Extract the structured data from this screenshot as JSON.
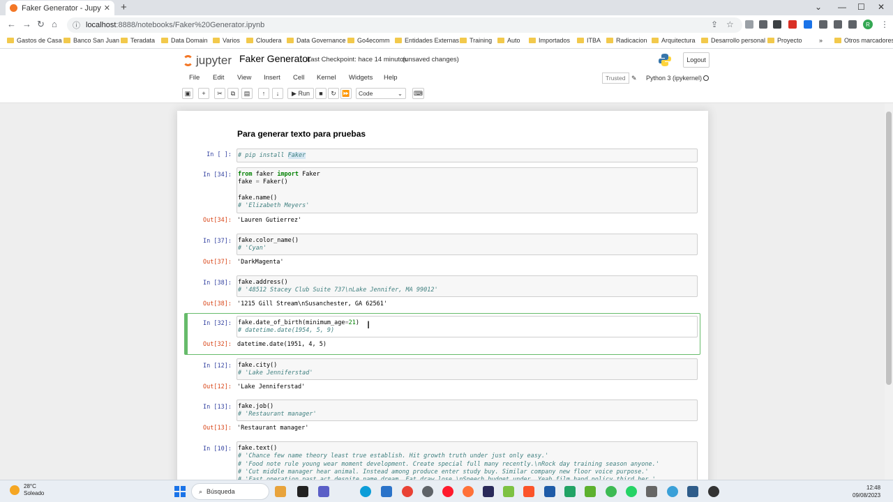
{
  "browser": {
    "tab_title": "Faker Generator - Jupyter Notebook",
    "new_tab": "+",
    "url_host": "localhost",
    "url_path": ":8888/notebooks/Faker%20Generator.ipynb",
    "bookmarks": [
      "Gastos de Casa",
      "Banco San Juan",
      "Teradata",
      "Data Domain",
      "Varios",
      "Cloudera",
      "Data Governance",
      "Go4ecomm",
      "Entidades Externas",
      "Training",
      "Auto",
      "Importados",
      "ITBA",
      "Radicacion",
      "Arquitectura",
      "Desarrollo personal",
      "Proyecto",
      "»",
      "Otros marcadores"
    ],
    "profile_initial": "R"
  },
  "jupyter": {
    "logo_text": "jupyter",
    "notebook_name": "Faker Generator",
    "checkpoint": "Last Checkpoint: hace 14 minutos",
    "unsaved": "(unsaved changes)",
    "logout": "Logout",
    "menus": [
      "File",
      "Edit",
      "View",
      "Insert",
      "Cell",
      "Kernel",
      "Widgets",
      "Help"
    ],
    "trusted": "Trusted",
    "kernel": "Python 3 (ipykernel)",
    "run_label": "Run",
    "cell_type": "Code"
  },
  "notebook": {
    "heading": "Para generar texto para pruebas",
    "cells": [
      {
        "in": "In [ ]:",
        "lines": [
          "# pip install Faker"
        ]
      },
      {
        "in": "In [34]:",
        "lines": [
          "from faker import Faker",
          "fake = Faker()",
          "",
          "fake.name()",
          "# 'Elizabeth Meyers'"
        ],
        "out_label": "Out[34]:",
        "out": "'Lauren Gutierrez'"
      },
      {
        "in": "In [37]:",
        "lines": [
          "fake.color_name()",
          "# 'Cyan'"
        ],
        "out_label": "Out[37]:",
        "out": "'DarkMagenta'"
      },
      {
        "in": "In [38]:",
        "lines": [
          "fake.address()",
          "# '48512 Stacey Club Suite 737\\nLake Jennifer, MA 99012'"
        ],
        "out_label": "Out[38]:",
        "out": "'1215 Gill Stream\\nSusanchester, GA 62561'"
      },
      {
        "in": "In [32]:",
        "lines": [
          "fake.date_of_birth(minimum_age=21)",
          "# datetime.date(1954, 5, 9)"
        ],
        "out_label": "Out[32]:",
        "out": "datetime.date(1951, 4, 5)"
      },
      {
        "in": "In [12]:",
        "lines": [
          "fake.city()",
          "# 'Lake Jenniferstad'"
        ],
        "out_label": "Out[12]:",
        "out": "'Lake Jenniferstad'"
      },
      {
        "in": "In [13]:",
        "lines": [
          "fake.job()",
          "# 'Restaurant manager'"
        ],
        "out_label": "Out[13]:",
        "out": "'Restaurant manager'"
      },
      {
        "in": "In [10]:",
        "lines": [
          "fake.text()",
          "# 'Chance few name theory least true establish. Hit growth truth under just only easy.'",
          "# 'Food note rule young wear moment development. Create special full many recently.\\nRock day training season anyone.'",
          "# 'Cut middle manager hear animal. Instead among produce enter study buy. Similar company new floor voice purpose.'",
          "# 'Fast operation past act despite name dream. Eat draw lose.\\nSpeech budget under. Yeah film hand policy third her.'"
        ]
      }
    ]
  },
  "taskbar": {
    "temp": "28°C",
    "weather": "Soleado",
    "search": "Búsqueda",
    "time": "12:48",
    "date": "09/08/2023"
  }
}
